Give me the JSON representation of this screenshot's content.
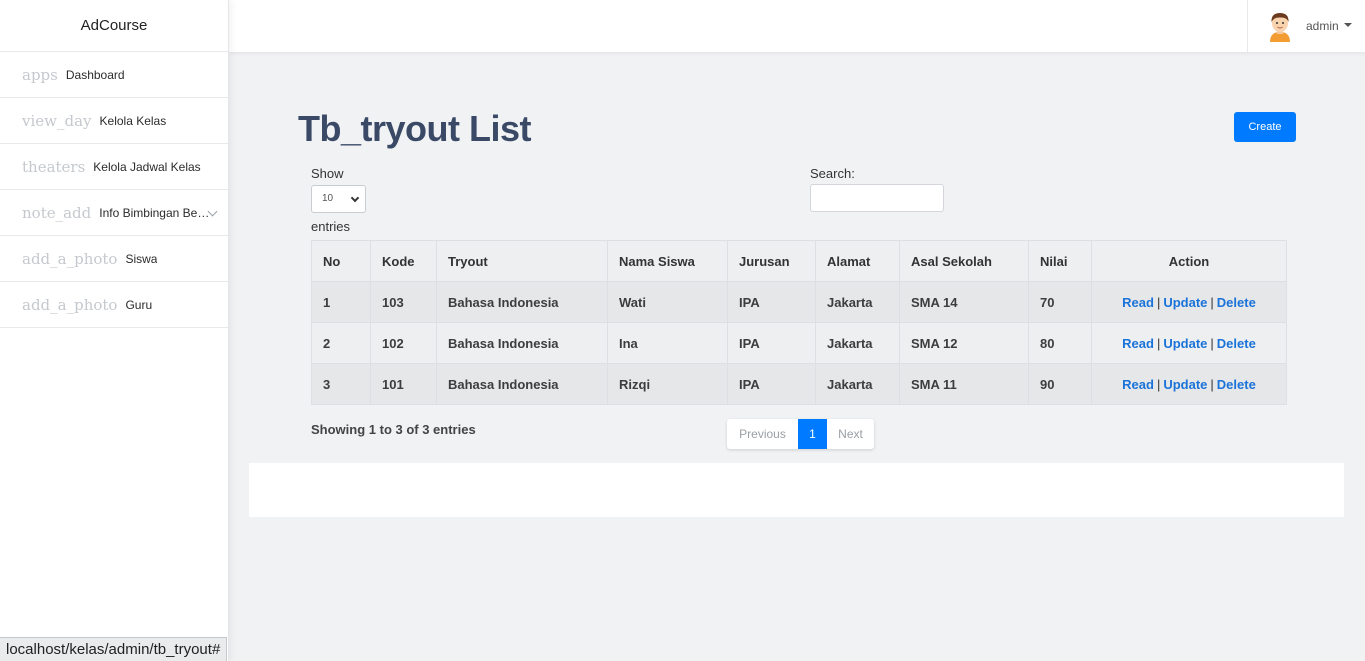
{
  "app": {
    "brand": "AdCourse"
  },
  "sidebar": {
    "items": [
      {
        "icon": "apps",
        "label": "Dashboard",
        "has_submenu": false
      },
      {
        "icon": "view_day",
        "label": "Kelola Kelas",
        "has_submenu": false
      },
      {
        "icon": "theaters",
        "label": "Kelola Jadwal Kelas",
        "has_submenu": false
      },
      {
        "icon": "note_add",
        "label": "Info Bimbingan Belajar",
        "has_submenu": true
      },
      {
        "icon": "add_a_photo",
        "label": "Siswa",
        "has_submenu": false
      },
      {
        "icon": "add_a_photo",
        "label": "Guru",
        "has_submenu": false
      }
    ]
  },
  "header": {
    "user_name": "admin"
  },
  "page": {
    "title": "Tb_tryout List",
    "create_label": "Create",
    "length": {
      "show_label": "Show",
      "selected": "10",
      "entries_label": "entries"
    },
    "search": {
      "label": "Search:",
      "value": ""
    },
    "table": {
      "columns": [
        "No",
        "Kode",
        "Tryout",
        "Nama Siswa",
        "Jurusan",
        "Alamat",
        "Asal Sekolah",
        "Nilai",
        "Action"
      ],
      "rows": [
        {
          "no": "1",
          "kode": "103",
          "tryout": "Bahasa Indonesia",
          "nama": "Wati",
          "jurusan": "IPA",
          "alamat": "Jakarta",
          "sekolah": "SMA 14",
          "nilai": "70"
        },
        {
          "no": "2",
          "kode": "102",
          "tryout": "Bahasa Indonesia",
          "nama": "Ina",
          "jurusan": "IPA",
          "alamat": "Jakarta",
          "sekolah": "SMA 12",
          "nilai": "80"
        },
        {
          "no": "3",
          "kode": "101",
          "tryout": "Bahasa Indonesia",
          "nama": "Rizqi",
          "jurusan": "IPA",
          "alamat": "Jakarta",
          "sekolah": "SMA 11",
          "nilai": "90"
        }
      ],
      "actions": {
        "read": "Read",
        "update": "Update",
        "delete": "Delete",
        "separator": "|"
      }
    },
    "info": "Showing 1 to 3 of 3 entries",
    "pagination": {
      "previous": "Previous",
      "current": "1",
      "next": "Next"
    }
  },
  "statusbar": {
    "url": "localhost/kelas/admin/tb_tryout#"
  },
  "colors": {
    "primary": "#007bff",
    "link": "#1a73d9",
    "title": "#3a4a66"
  }
}
